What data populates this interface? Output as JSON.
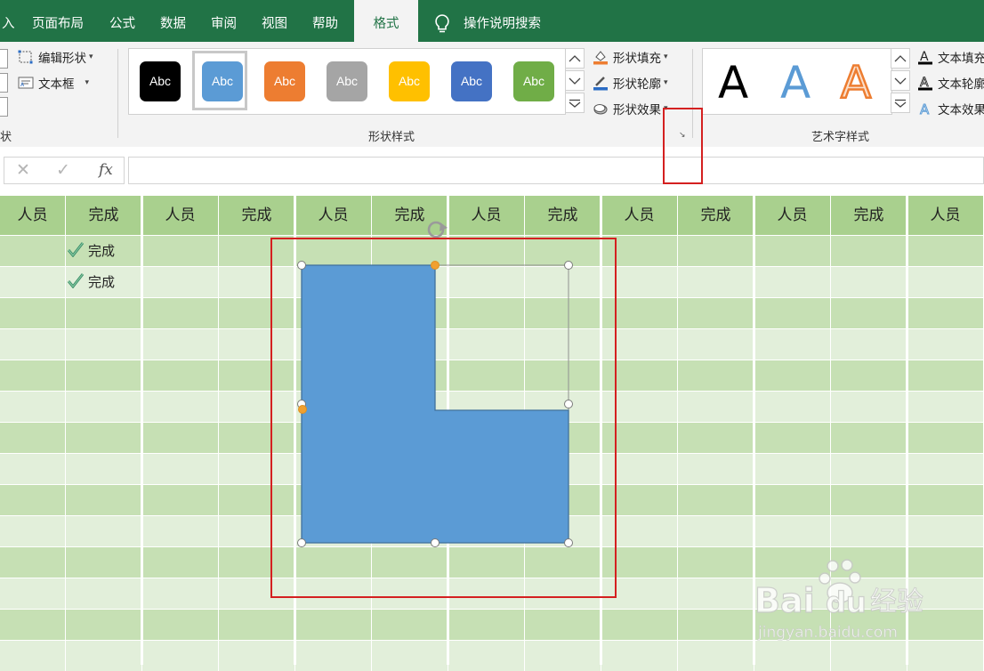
{
  "tabs": [
    {
      "label": "入",
      "active": false
    },
    {
      "label": "页面布局",
      "active": false
    },
    {
      "label": "公式",
      "active": false
    },
    {
      "label": "数据",
      "active": false
    },
    {
      "label": "审阅",
      "active": false
    },
    {
      "label": "视图",
      "active": false
    },
    {
      "label": "帮助",
      "active": false
    },
    {
      "label": "格式",
      "active": true
    }
  ],
  "tell_me": "操作说明搜索",
  "ribbon": {
    "insert_shapes": {
      "edit_shape": "编辑形状",
      "text_box": "文本框",
      "group_label": "状"
    },
    "shape_styles": {
      "group_label": "形状样式",
      "swatches": [
        {
          "label": "Abc",
          "color": "#000000"
        },
        {
          "label": "Abc",
          "color": "#5b9bd5",
          "selected": true
        },
        {
          "label": "Abc",
          "color": "#ed7d31"
        },
        {
          "label": "Abc",
          "color": "#a5a5a5"
        },
        {
          "label": "Abc",
          "color": "#ffc000"
        },
        {
          "label": "Abc",
          "color": "#4472c4"
        },
        {
          "label": "Abc",
          "color": "#70ad47"
        }
      ],
      "shape_fill": "形状填充",
      "shape_outline": "形状轮廓",
      "shape_effects": "形状效果"
    },
    "wordart_styles": {
      "group_label": "艺术字样式",
      "letters": [
        {
          "label": "A",
          "color": "#000000"
        },
        {
          "label": "A",
          "color": "#5b9bd5"
        },
        {
          "label": "A",
          "color": "#ed7d31"
        }
      ],
      "text_fill": "文本填充",
      "text_outline": "文本轮廓",
      "text_effects": "文本效果"
    }
  },
  "formula_bar": {
    "cancel": "✕",
    "enter": "✓",
    "fx": "fx",
    "value": ""
  },
  "sheet": {
    "header": [
      "人员",
      "完成",
      "人员",
      "完成",
      "人员",
      "完成",
      "人员",
      "完成",
      "人员",
      "完成",
      "人员",
      "完成",
      "人员"
    ],
    "done_label": "完成",
    "done_rows": [
      "完成",
      "完成"
    ]
  },
  "shape": {
    "name": "L-shape",
    "fill": "#5b9bd5"
  },
  "colors": {
    "accent": "#217346",
    "header_green": "#a9d08e",
    "row_dark": "#c6e0b4",
    "row_light": "#e2efda",
    "highlight_red": "#d42020"
  },
  "watermark": {
    "brand": "Bai",
    "brand2": "du",
    "cn": "经验",
    "url": "jingyan.baidu.com"
  }
}
